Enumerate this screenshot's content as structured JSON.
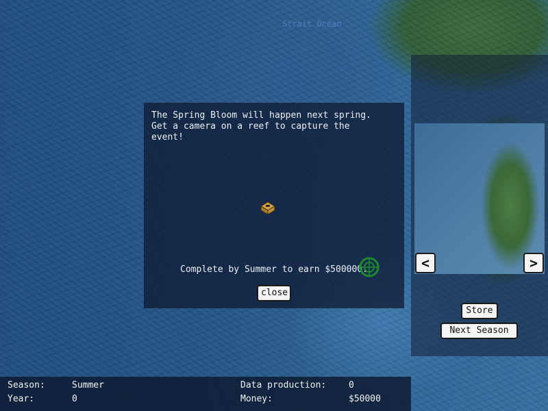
{
  "map": {
    "label": "Strait Ocean"
  },
  "dialog": {
    "message": "The Spring Bloom will happen next spring.\nGet a camera on a reef to capture the\nevent!",
    "reward": "Complete by Summer to earn $500000.",
    "close_label": "close"
  },
  "side_panel": {
    "prev_label": "<",
    "next_label": ">",
    "store_label": "Store",
    "next_season_label": "Next Season"
  },
  "status": {
    "season_label": "Season:",
    "season_value": "Summer",
    "year_label": "Year:",
    "year_value": "0",
    "data_label": "Data production:",
    "data_value": "0",
    "money_label": "Money:",
    "money_value": "$50000"
  },
  "icons": {
    "camera": "camera-icon",
    "target": "target-icon"
  },
  "colors": {
    "ocean": "#1f4f82",
    "land": "#3a6838",
    "button_bg": "#f4f4f4",
    "panel_bg": "#101c36"
  }
}
